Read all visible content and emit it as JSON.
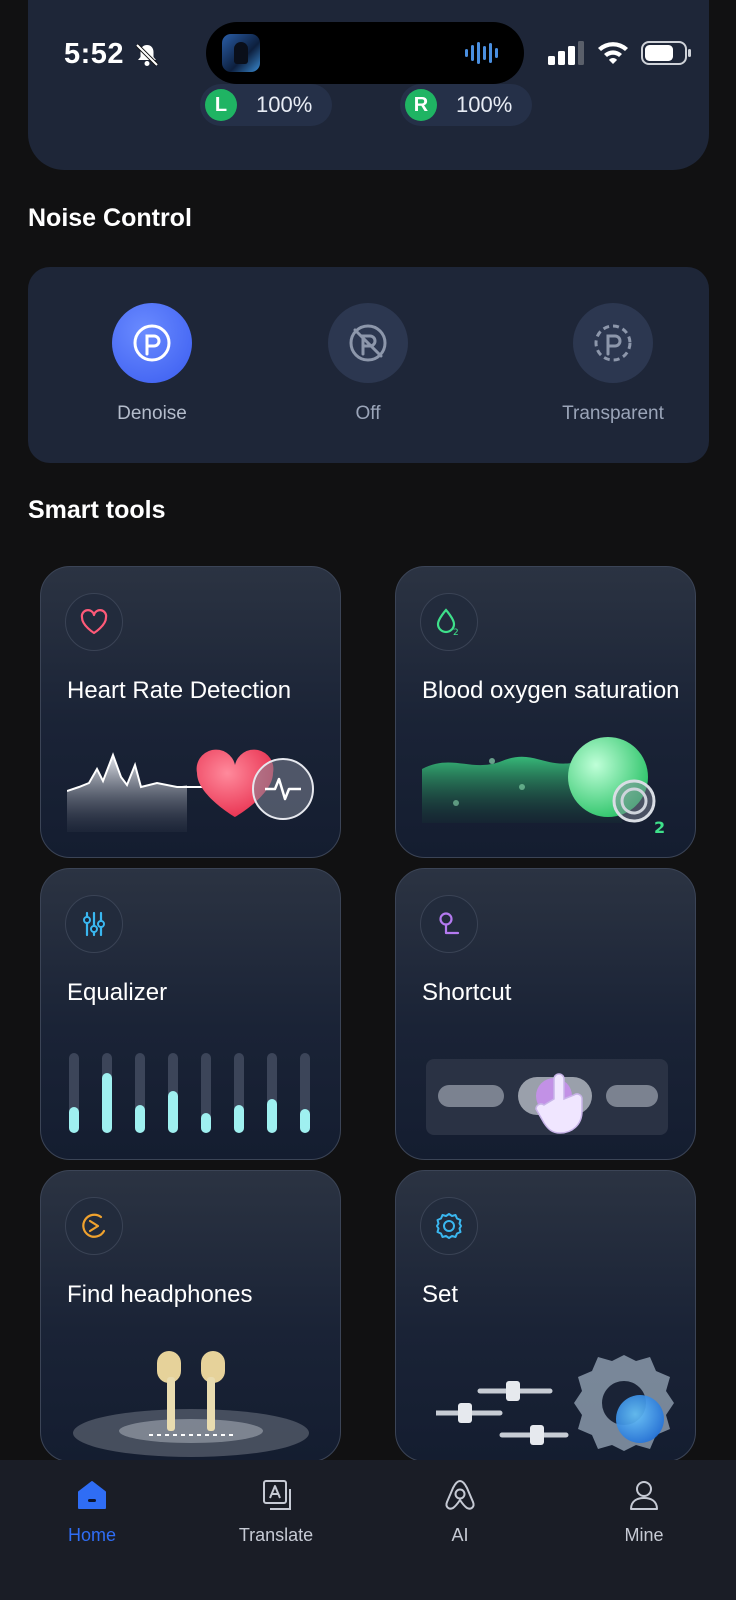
{
  "status_bar": {
    "time": "5:52"
  },
  "earbuds": {
    "left": {
      "badge": "L",
      "battery": "100%"
    },
    "right": {
      "badge": "R",
      "battery": "100%"
    }
  },
  "noise_control": {
    "title": "Noise Control",
    "options": [
      {
        "label": "Denoise",
        "icon": "denoise-icon",
        "active": true
      },
      {
        "label": "Off",
        "icon": "off-icon",
        "active": false
      },
      {
        "label": "Transparent",
        "icon": "transparent-icon",
        "active": false
      }
    ]
  },
  "smart_tools": {
    "title": "Smart tools",
    "items": [
      {
        "title": "Heart Rate Detection",
        "icon": "heart-icon"
      },
      {
        "title": "Blood oxygen saturation",
        "icon": "blood-oxygen-icon"
      },
      {
        "title": "Equalizer",
        "icon": "equalizer-icon"
      },
      {
        "title": "Shortcut",
        "icon": "shortcut-icon"
      },
      {
        "title": "Find headphones",
        "icon": "find-headphones-icon"
      },
      {
        "title": "Set",
        "icon": "gear-icon"
      }
    ]
  },
  "bottom_nav": {
    "items": [
      {
        "label": "Home",
        "icon": "home-icon",
        "active": true
      },
      {
        "label": "Translate",
        "icon": "translate-icon",
        "active": false
      },
      {
        "label": "AI",
        "icon": "ai-icon",
        "active": false
      },
      {
        "label": "Mine",
        "icon": "user-icon",
        "active": false
      }
    ]
  },
  "colors": {
    "accent": "#2f6df5",
    "card": "#1e2638",
    "battery_badge": "#1fb463",
    "heart": "#ff5a78",
    "oxygen": "#3ee08a",
    "equalizer": "#9ff0f0"
  }
}
